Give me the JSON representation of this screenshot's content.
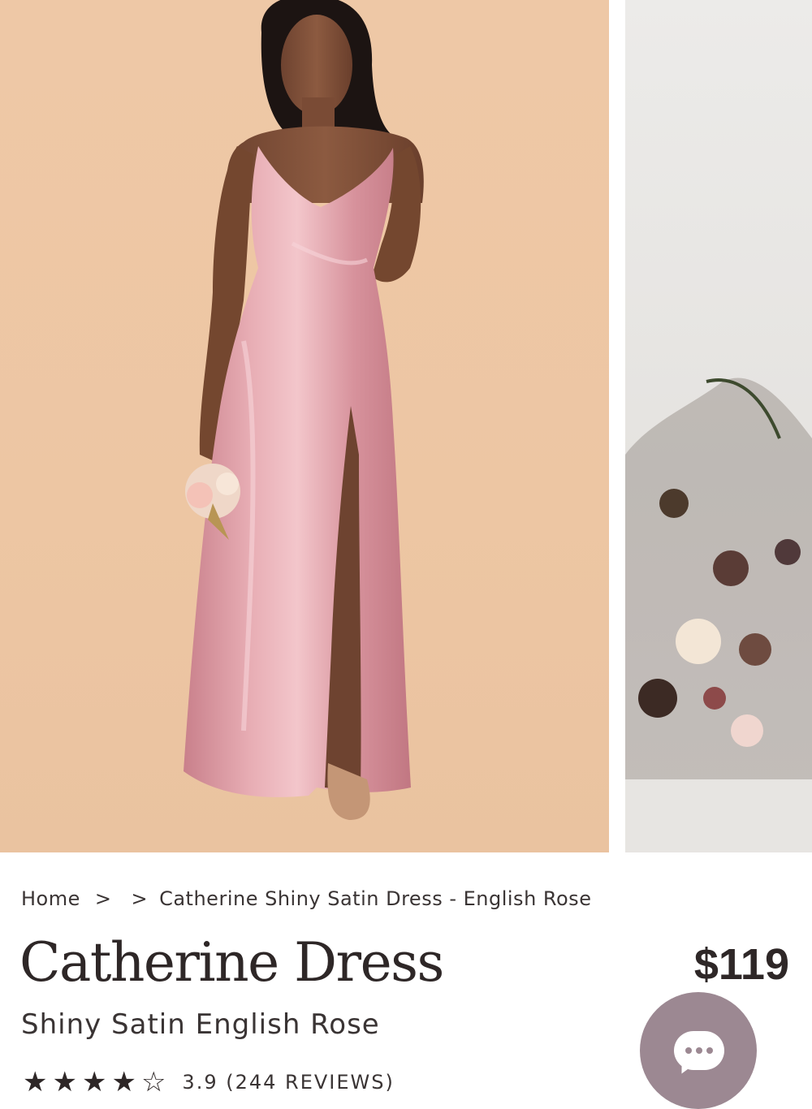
{
  "gallery": {
    "main_image_alt": "Model wearing pink shiny satin slip dress holding a small bouquet",
    "next_image_alt": "Floral arch arrangement with roses and greenery"
  },
  "breadcrumb": {
    "home": "Home",
    "separator": ">",
    "middle": "",
    "current": "Catherine Shiny Satin Dress - English Rose"
  },
  "product": {
    "title": "Catherine Dress",
    "subtitle": "Shiny Satin English Rose",
    "price": "$119",
    "rating_text": "3.9 (244 REVIEWS)",
    "stars": [
      "★",
      "★",
      "★",
      "★",
      "☆"
    ]
  },
  "chat": {
    "icon": "chat-bubble-icon",
    "color": "#9c8892"
  },
  "colors": {
    "backdrop": "#eec8a6",
    "dress": "#d9959e",
    "text": "#2e2727"
  }
}
